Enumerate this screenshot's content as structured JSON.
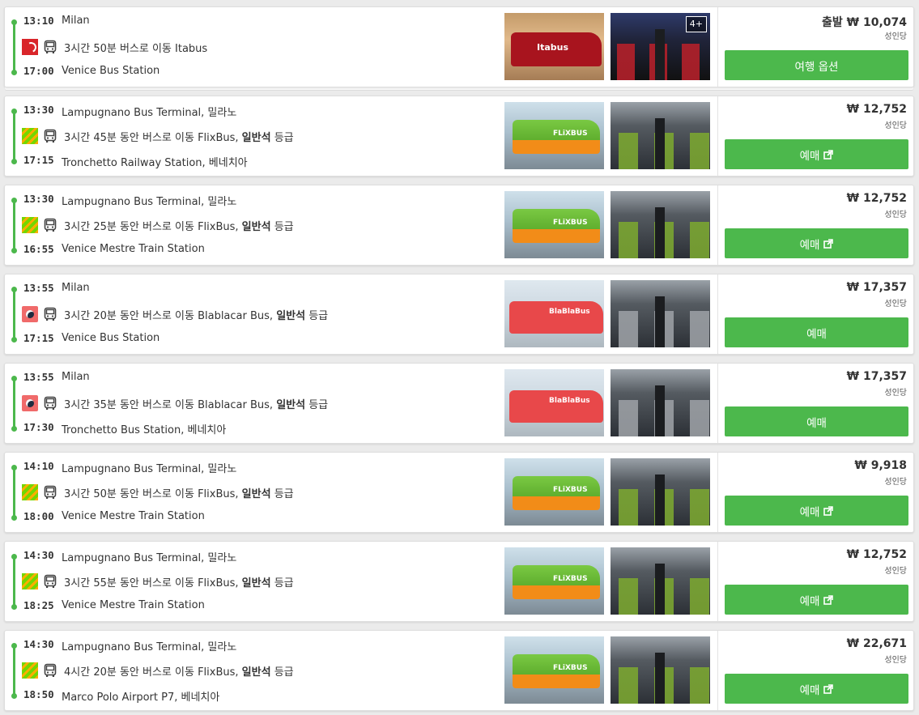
{
  "trips": [
    {
      "dep_time": "13:10",
      "dep_station": "Milan",
      "duration_desc": "3시간 50분 버스로 이동 Itabus",
      "fare_class": "",
      "class_suffix": "",
      "arr_time": "17:00",
      "arr_station": "Venice Bus Station",
      "operator_icon": "itabus-logo-icon",
      "photo_label": "Itabus",
      "photo_badge": "4+",
      "price": "출발 ₩ 10,074",
      "per_adult": "성인당",
      "button_label": "여행 옵션",
      "button_external": false,
      "photo_ext": "itabus",
      "photo_int": "itabus"
    },
    {
      "dep_time": "13:30",
      "dep_station": "Lampugnano Bus Terminal, 밀라노",
      "duration_desc": "3시간 45분 동안 버스로 이동 FlixBus, ",
      "fare_class": "일반석",
      "class_suffix": " 등급",
      "arr_time": "17:15",
      "arr_station": "Tronchetto Railway Station, 베네치아",
      "operator_icon": "flixbus-logo-icon",
      "photo_label": "FLiXBUS",
      "photo_badge": "",
      "price": "₩ 12,752",
      "per_adult": "성인당",
      "button_label": "예매",
      "button_external": true,
      "photo_ext": "flix",
      "photo_int": "green"
    },
    {
      "dep_time": "13:30",
      "dep_station": "Lampugnano Bus Terminal, 밀라노",
      "duration_desc": "3시간 25분 동안 버스로 이동 FlixBus, ",
      "fare_class": "일반석",
      "class_suffix": " 등급",
      "arr_time": "16:55",
      "arr_station": "Venice Mestre Train Station",
      "operator_icon": "flixbus-logo-icon",
      "photo_label": "FLiXBUS",
      "photo_badge": "",
      "price": "₩ 12,752",
      "per_adult": "성인당",
      "button_label": "예매",
      "button_external": true,
      "photo_ext": "flix",
      "photo_int": "green"
    },
    {
      "dep_time": "13:55",
      "dep_station": "Milan",
      "duration_desc": "3시간 20분 동안 버스로 이동 Blablacar Bus, ",
      "fare_class": "일반석",
      "class_suffix": " 등급",
      "arr_time": "17:15",
      "arr_station": "Venice Bus Station",
      "operator_icon": "blablacar-logo-icon",
      "photo_label": "BlaBlaBus",
      "photo_badge": "",
      "price": "₩ 17,357",
      "per_adult": "성인당",
      "button_label": "예매",
      "button_external": false,
      "photo_ext": "blabla",
      "photo_int": "grey"
    },
    {
      "dep_time": "13:55",
      "dep_station": "Milan",
      "duration_desc": "3시간 35분 동안 버스로 이동 Blablacar Bus, ",
      "fare_class": "일반석",
      "class_suffix": " 등급",
      "arr_time": "17:30",
      "arr_station": "Tronchetto Bus Station, 베네치아",
      "operator_icon": "blablacar-logo-icon",
      "photo_label": "BlaBlaBus",
      "photo_badge": "",
      "price": "₩ 17,357",
      "per_adult": "성인당",
      "button_label": "예매",
      "button_external": false,
      "photo_ext": "blabla",
      "photo_int": "grey"
    },
    {
      "dep_time": "14:10",
      "dep_station": "Lampugnano Bus Terminal, 밀라노",
      "duration_desc": "3시간 50분 동안 버스로 이동 FlixBus, ",
      "fare_class": "일반석",
      "class_suffix": " 등급",
      "arr_time": "18:00",
      "arr_station": "Venice Mestre Train Station",
      "operator_icon": "flixbus-logo-icon",
      "photo_label": "FLiXBUS",
      "photo_badge": "",
      "price": "₩ 9,918",
      "per_adult": "성인당",
      "button_label": "예매",
      "button_external": true,
      "photo_ext": "flix",
      "photo_int": "green"
    },
    {
      "dep_time": "14:30",
      "dep_station": "Lampugnano Bus Terminal, 밀라노",
      "duration_desc": "3시간 55분 동안 버스로 이동 FlixBus, ",
      "fare_class": "일반석",
      "class_suffix": " 등급",
      "arr_time": "18:25",
      "arr_station": "Venice Mestre Train Station",
      "operator_icon": "flixbus-logo-icon",
      "photo_label": "FLiXBUS",
      "photo_badge": "",
      "price": "₩ 12,752",
      "per_adult": "성인당",
      "button_label": "예매",
      "button_external": true,
      "photo_ext": "flix",
      "photo_int": "green"
    },
    {
      "dep_time": "14:30",
      "dep_station": "Lampugnano Bus Terminal, 밀라노",
      "duration_desc": "4시간 20분 동안 버스로 이동 FlixBus, ",
      "fare_class": "일반석",
      "class_suffix": " 등급",
      "arr_time": "18:50",
      "arr_station": "Marco Polo Airport P7, 베네치아",
      "operator_icon": "flixbus-logo-icon",
      "photo_label": "FLiXBUS",
      "photo_badge": "",
      "price": "₩ 22,671",
      "per_adult": "성인당",
      "button_label": "예매",
      "button_external": true,
      "photo_ext": "flix",
      "photo_int": "green"
    }
  ],
  "colors": {
    "accent": "#4cb84c",
    "flix_green": "#73d700",
    "flix_orange": "#ffad00",
    "itabus_red": "#d9252a",
    "blabla_red": "#f06a6a"
  }
}
